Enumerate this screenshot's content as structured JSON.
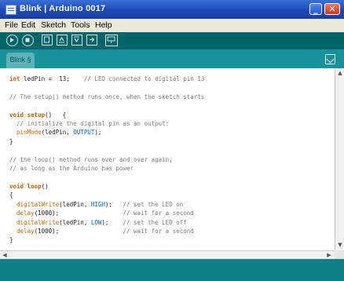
{
  "window": {
    "title": "Blink | Arduino 0017"
  },
  "menu": {
    "items": [
      "File",
      "Edit",
      "Sketch",
      "Tools",
      "Help"
    ]
  },
  "toolbar": {
    "buttons": [
      {
        "name": "verify",
        "icon": "play-icon"
      },
      {
        "name": "stop",
        "icon": "stop-icon"
      },
      {
        "name": "new",
        "icon": "new-file-icon"
      },
      {
        "name": "open",
        "icon": "open-icon"
      },
      {
        "name": "save",
        "icon": "save-icon"
      },
      {
        "name": "upload",
        "icon": "upload-icon"
      },
      {
        "name": "serial-monitor",
        "icon": "serial-monitor-icon"
      }
    ]
  },
  "tabs": [
    {
      "label": "Blink §",
      "active": true
    }
  ],
  "editor": {
    "lines": [
      "int ledPin =  13;    // LED connected to digital pin 13",
      "",
      "// The setup() method runs once, when the sketch starts",
      "",
      "void setup()   {",
      "  // initialize the digital pin as an output:",
      "  pinMode(ledPin, OUTPUT);",
      "}",
      "",
      "// the loop() method runs over and over again,",
      "// as long as the Arduino has power",
      "",
      "void loop()",
      "{",
      "  digitalWrite(ledPin, HIGH);   // set the LED on",
      "  delay(1000);                  // wait for a second",
      "  digitalWrite(ledPin, LOW);    // set the LED off",
      "  delay(1000);                  // wait for a second",
      "}"
    ]
  },
  "colors": {
    "toolbar_bg": "#006468",
    "tabrow_bg": "#17919a",
    "status_bg": "#0e7e85",
    "keyword": "#cc6600",
    "constant": "#0066cc",
    "comment": "#7e7e7e"
  }
}
